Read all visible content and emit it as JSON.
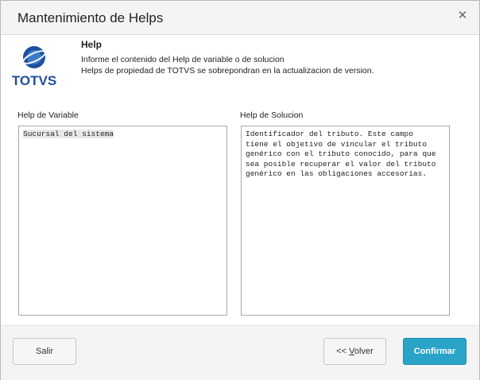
{
  "window": {
    "title": "Mantenimiento de Helps",
    "close_icon": "close-icon"
  },
  "header": {
    "logo_text": "TOTVS",
    "help_title": "Help",
    "line1": "Informe el contenido del Help de variable o de solucion",
    "line2": "Helps de propiedad de TOTVS se sobrepondran en la actualizacion de version."
  },
  "fields": {
    "variable_label": "Help de Variable",
    "variable_value": "Sucursal del sistema",
    "solucion_label": "Help de Solucion",
    "solucion_value": "Identificador del tributo. Este campo\ntiene el objetivo de vincular el tributo\ngenérico con el tributo conocido, para que\nsea posible recuperar el valor del tributo\ngenérico en las obligaciones accesorias."
  },
  "buttons": {
    "salir": "Salir",
    "volver_prefix": "<< ",
    "volver_accel": "V",
    "volver_rest": "olver",
    "confirmar": "Confirmar"
  },
  "colors": {
    "accent": "#2aa3c9",
    "logo_blue": "#1f4f9c"
  }
}
